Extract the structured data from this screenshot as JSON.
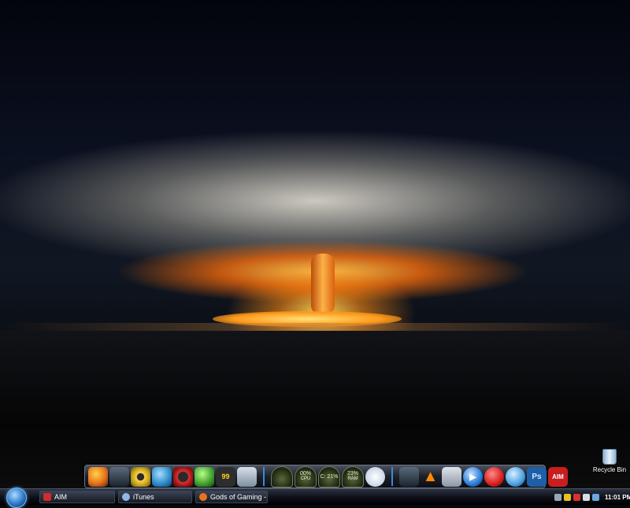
{
  "desktop": {
    "recycle_bin_label": "Recycle Bin"
  },
  "dock": {
    "icons": [
      {
        "name": "firefox-icon",
        "glyph": "",
        "color": "#e8731c"
      },
      {
        "name": "steam-icon",
        "glyph": "",
        "color": "#2a3a4c"
      },
      {
        "name": "target-icon",
        "glyph": "",
        "color": "#c7a61e"
      },
      {
        "name": "globe-icon",
        "glyph": "",
        "color": "#2b8ac7"
      },
      {
        "name": "red-ring-icon",
        "glyph": "",
        "color": "#b81c1c"
      },
      {
        "name": "green-grid-icon",
        "glyph": "",
        "color": "#3e9d2d"
      },
      {
        "name": "score-99-icon",
        "glyph": "99",
        "color": "#2d2d2d"
      },
      {
        "name": "monitor-icon",
        "glyph": "",
        "color": "#7f8fa0"
      }
    ],
    "system_gauges": [
      {
        "name": "blank-gauge",
        "pct": "",
        "label": ""
      },
      {
        "name": "cpu-gauge",
        "pct": "00%",
        "label": "CPU"
      },
      {
        "name": "drive-gauge",
        "pct": "C: 21%",
        "label": ""
      },
      {
        "name": "ram-gauge",
        "pct": "23%",
        "label": "RAM"
      }
    ],
    "apps": [
      {
        "name": "terminal-icon",
        "glyph": "",
        "color": "#3a4a5a"
      },
      {
        "name": "vlc-icon",
        "glyph": "▲",
        "color": "#ff8a00"
      },
      {
        "name": "drive-icon",
        "glyph": "",
        "color": "#8c96a6"
      },
      {
        "name": "media-player-icon",
        "glyph": "▶",
        "color": "#2b7bd6"
      },
      {
        "name": "aim-running-man-icon",
        "glyph": "",
        "color": "#d81c1c"
      },
      {
        "name": "network-icon",
        "glyph": "",
        "color": "#4a9fe0"
      },
      {
        "name": "photoshop-icon",
        "glyph": "Ps",
        "color": "#1f5fa8"
      },
      {
        "name": "aim-icon",
        "glyph": "AIM",
        "color": "#c81e1e"
      }
    ],
    "colors": {
      "separator": "#3b8bd8"
    }
  },
  "taskbar": {
    "tasks": [
      {
        "name": "task-aim",
        "label": "AIM",
        "color": "#d32a2a"
      },
      {
        "name": "task-itunes",
        "label": "iTunes",
        "color": "#8fb8e8"
      },
      {
        "name": "task-gods-of-gaming",
        "label": "Gods of Gaming - ...",
        "color": "#e8731c"
      }
    ],
    "clock": "11:01 PM"
  }
}
